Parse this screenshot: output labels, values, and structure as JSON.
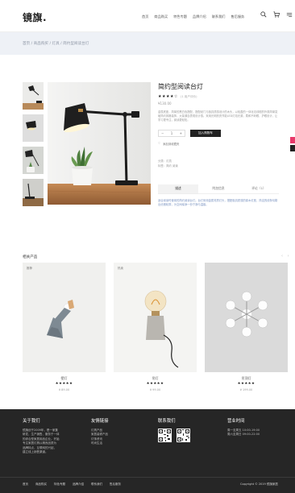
{
  "header": {
    "logo": "镜旗.",
    "nav": [
      "首页",
      "商品购买",
      "特色专题",
      "品牌介绍",
      "联系我们",
      "售后服务"
    ]
  },
  "breadcrumb": "首页 / 商品购买 / 灯具 / 简约型阅读台灯",
  "product": {
    "title": "简约型阅读台灯",
    "stars": "★★★★☆",
    "review_count": "(1 用户评价)",
    "price": "¥130.00",
    "description": "金属底座，简单的黑白色搭配，搭配纸门与极具质感设计的木头，以轻盈的一体化法线帽的外观简单突破简约风格装饰，大量源自表现设计感。采用光明亮亮节能LED灯泡光源，柔和不刺眼，护眼设计，让学习更专注，阅读更轻松。",
    "quantity": "1",
    "add_to_cart": "加入购物车",
    "wishlist": "添加到收藏夹",
    "category": "分类：灯具",
    "tags": "标签：简约 阅读",
    "tabs": [
      "描述",
      "附加信息",
      "评论（1）"
    ],
    "tab_content": "适合阅读时使用的简约阅读台灯。台灯采用金属材质灯头，搭配极具质感的原木灯座，简洁的线条勾勒出优雅轮廓，为空间增添一份宁静与温馨。"
  },
  "related": {
    "title": "相关产品",
    "arrows": "‹ ›",
    "items": [
      {
        "badge": "推荐",
        "name": "壁灯",
        "stars": "★★★★★",
        "price": "¥ 89.00"
      },
      {
        "badge": "热卖",
        "name": "吊灯",
        "stars": "★★★★★",
        "price": "¥ 99.00"
      },
      {
        "badge": "",
        "name": "吊顶灯",
        "stars": "★★★★★",
        "price": "¥ 199.00"
      }
    ]
  },
  "footer": {
    "about": {
      "title": "关于我们",
      "lines": [
        "镜旗创于2009年，是一家集",
        "研发、生产销售、服务于一体",
        "的综合型家居用品企业。开始",
        "专注家居灯具以精良品质为",
        "品牌特点，互联网的兴起，",
        "建立线上销售渠道。"
      ]
    },
    "links": {
      "title": "友情链接",
      "lines": [
        "灯具产品",
        "家居装修产品",
        "灯饰资讯",
        "时尚生活"
      ]
    },
    "contact": {
      "title": "联系我们"
    },
    "hours": {
      "title": "营业时间",
      "lines": [
        "周一至周五    10:00-19:00",
        "周六至周日    09:00-22:00"
      ]
    },
    "bottom_links": [
      "首页",
      "商品购买",
      "特色专题",
      "品牌介绍",
      "联系我们",
      "售后服务"
    ],
    "copyright": "Copyright © 2019 镜旗家居"
  }
}
